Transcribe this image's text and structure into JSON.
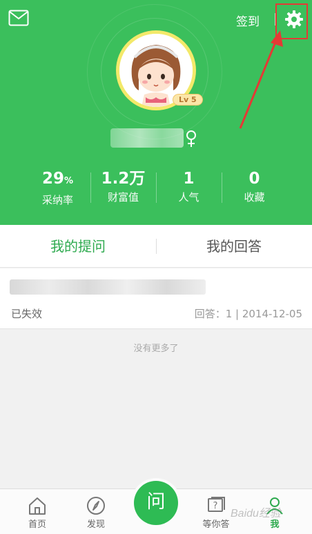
{
  "header": {
    "checkin_label": "签到",
    "level_badge": "Lv 5"
  },
  "stats": [
    {
      "value": "29",
      "unit": "%",
      "label": "采纳率"
    },
    {
      "value": "1.2万",
      "unit": "",
      "label": "财富值"
    },
    {
      "value": "1",
      "unit": "",
      "label": "人气"
    },
    {
      "value": "0",
      "unit": "",
      "label": "收藏"
    }
  ],
  "tabs": [
    {
      "label": "我的提问",
      "active": true
    },
    {
      "label": "我的回答",
      "active": false
    }
  ],
  "question": {
    "status": "已失效",
    "meta": "回答：1 | 2014-12-05"
  },
  "no_more": "没有更多了",
  "nav": {
    "home": "首页",
    "discover": "发现",
    "ask": "问",
    "waiting": "等你答",
    "me": "我"
  },
  "watermark": "Baidu经验",
  "colors": {
    "brand_green": "#3bbf5c",
    "active_green": "#2eaa4f",
    "highlight_red": "#e53935"
  },
  "icons": [
    "mail-icon",
    "gear-icon",
    "female-icon",
    "home-icon",
    "compass-icon",
    "question-box-icon",
    "person-icon"
  ]
}
